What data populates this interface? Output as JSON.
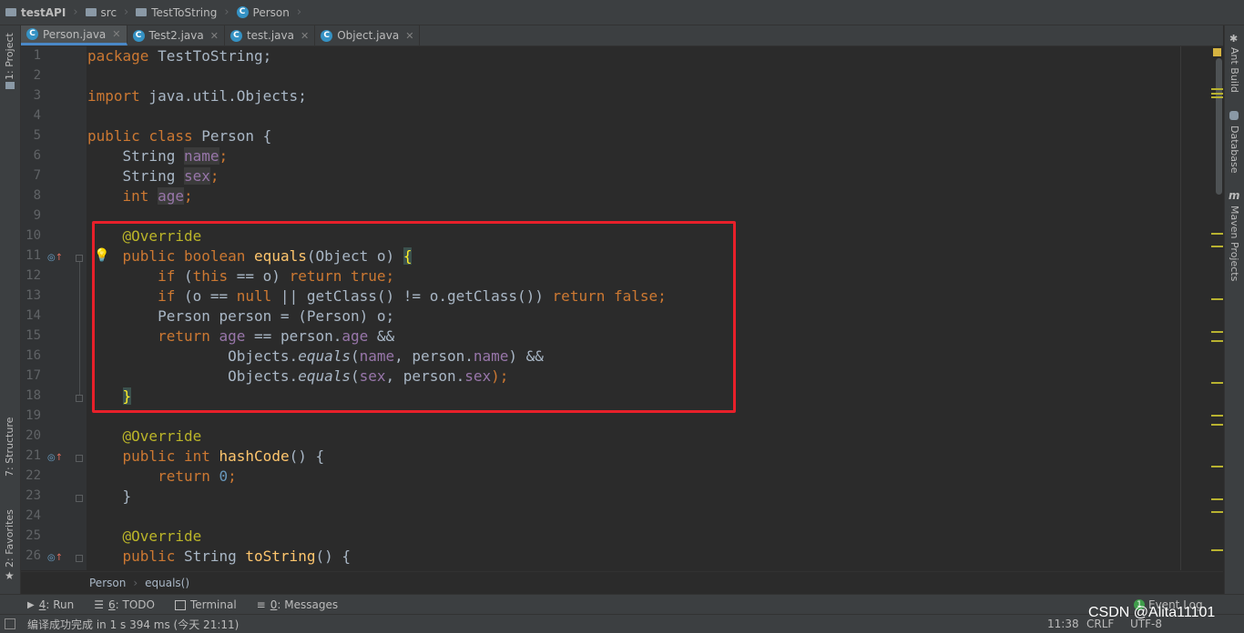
{
  "breadcrumb": [
    "testAPI",
    "src",
    "TestToString",
    "Person"
  ],
  "tabs": [
    {
      "label": "Person.java",
      "active": true
    },
    {
      "label": "Test2.java",
      "active": false
    },
    {
      "label": "test.java",
      "active": false
    },
    {
      "label": "Object.java",
      "active": false
    }
  ],
  "left_panel": {
    "project": "1: Project",
    "structure": "7: Structure",
    "favorites": "2: Favorites"
  },
  "right_panel": {
    "ant": "Ant Build",
    "database": "Database",
    "maven": "Maven Projects"
  },
  "line_numbers": [
    "1",
    "2",
    "3",
    "4",
    "5",
    "6",
    "7",
    "8",
    "9",
    "10",
    "11",
    "12",
    "13",
    "14",
    "15",
    "16",
    "17",
    "18",
    "19",
    "20",
    "21",
    "22",
    "23",
    "24",
    "25",
    "26"
  ],
  "code": {
    "l1": [
      "package",
      " TestToString;"
    ],
    "l3": [
      "import",
      " java.util.Objects;"
    ],
    "l5": [
      "public",
      " ",
      "class",
      " Person {"
    ],
    "l6": [
      "    String ",
      "name",
      ";"
    ],
    "l7": [
      "    String ",
      "sex",
      ";"
    ],
    "l8": [
      "    ",
      "int",
      " ",
      "age",
      ";"
    ],
    "l10": [
      "    ",
      "@Override"
    ],
    "l11": [
      "    ",
      "public",
      " ",
      "boolean",
      " ",
      "equals",
      "(Object o) ",
      "{"
    ],
    "l12": [
      "        ",
      "if",
      " (",
      "this",
      " == o) ",
      "return",
      " ",
      "true",
      ";"
    ],
    "l13": [
      "        ",
      "if",
      " (o == ",
      "null",
      " || getClass() != o.getClass()) ",
      "return",
      " ",
      "false",
      ";"
    ],
    "l14": [
      "        Person person = (Person) o;"
    ],
    "l15": [
      "        ",
      "return",
      " ",
      "age",
      " == person.",
      "age",
      " &&"
    ],
    "l16": [
      "                Objects.",
      "equals",
      "(",
      "name",
      ", person.",
      "name",
      ") &&"
    ],
    "l17": [
      "                Objects.",
      "equals",
      "(",
      "sex",
      ", person.",
      "sex",
      ");"
    ],
    "l18": [
      "    ",
      "}"
    ],
    "l20": [
      "    ",
      "@Override"
    ],
    "l21": [
      "    ",
      "public",
      " ",
      "int",
      " ",
      "hashCode",
      "() {"
    ],
    "l22": [
      "        ",
      "return",
      " ",
      "0",
      ";"
    ],
    "l23": [
      "    }"
    ],
    "l25": [
      "    ",
      "@Override"
    ],
    "l26": [
      "    ",
      "public",
      " String ",
      "toString",
      "() {"
    ]
  },
  "editor_breadcrumb": [
    "Person",
    "equals()"
  ],
  "tool_windows": [
    {
      "key": "4",
      "label": ": Run"
    },
    {
      "key": "6",
      "label": ": TODO"
    },
    {
      "key": "",
      "label": "Terminal"
    },
    {
      "key": "0",
      "label": ": Messages"
    }
  ],
  "event_log": {
    "count": "1",
    "label": "Event Log"
  },
  "status": {
    "message": "编译成功完成 in 1 s 394 ms (今天 21:11)",
    "position": "11:38",
    "line_sep": "CRLF",
    "encoding": "UTF-8"
  },
  "watermark": "CSDN @Alita11101",
  "colors": {
    "keyword": "#cc7832",
    "field": "#9876aa",
    "annotation": "#bbb529",
    "method": "#ffc66d",
    "number": "#6897bb",
    "highlight_box": "#e8202a"
  }
}
